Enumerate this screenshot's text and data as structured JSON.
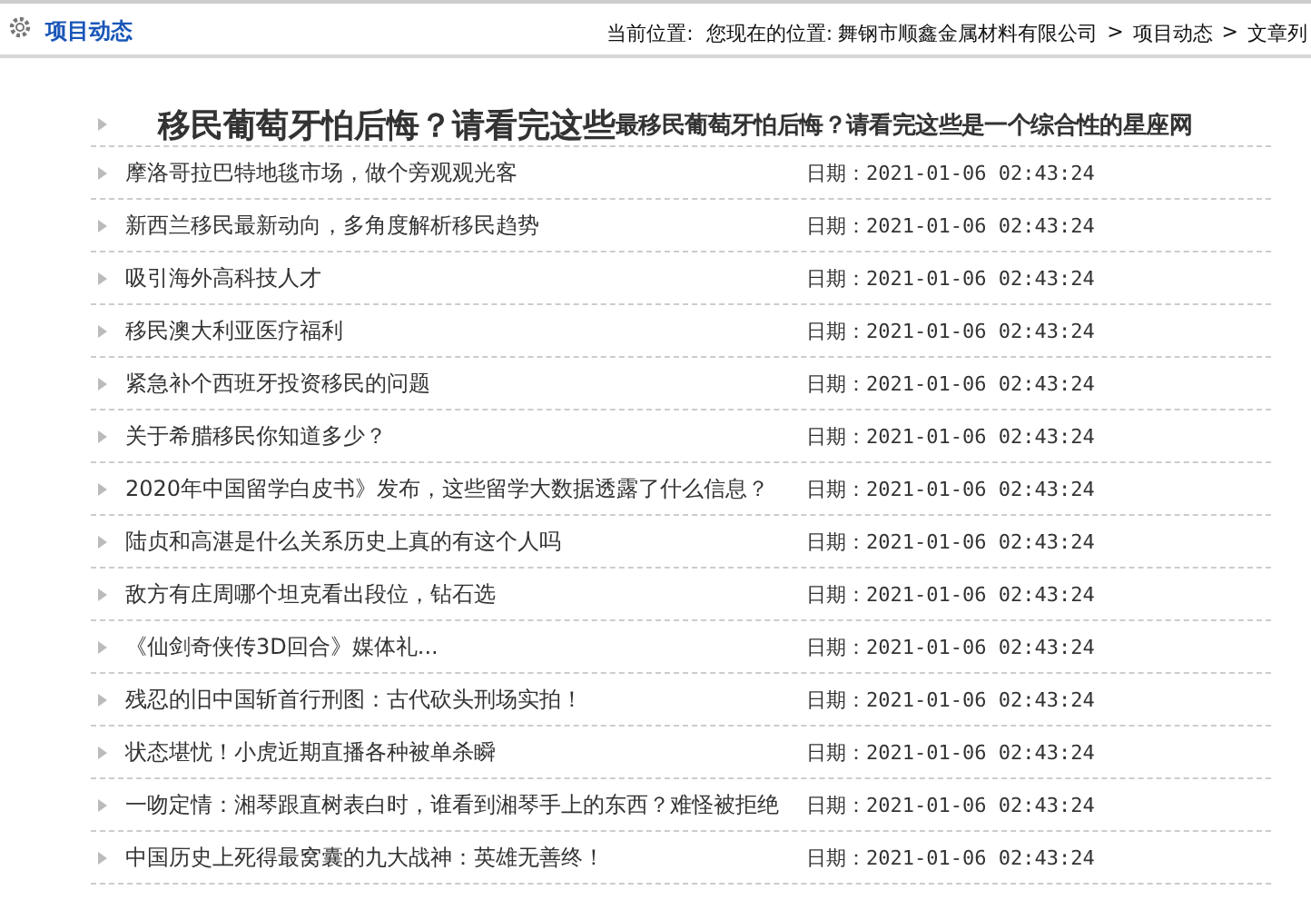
{
  "header": {
    "title": "项目动态",
    "breadcrumb_label": "当前位置:",
    "breadcrumb": [
      {
        "text": "您现在的位置:",
        "kind": "text"
      },
      {
        "text": "舞钢市顺鑫金属材料有限公司",
        "kind": "link"
      },
      {
        "text": ">",
        "kind": "sep"
      },
      {
        "text": "项目动态",
        "kind": "link"
      },
      {
        "text": ">",
        "kind": "sep"
      },
      {
        "text": "文章列",
        "kind": "link"
      }
    ]
  },
  "headline": {
    "title": "移民葡萄牙怕后悔？请看完这些",
    "subtitle": "最移民葡萄牙怕后悔？请看完这些是一个综合性的星座网"
  },
  "articles": [
    {
      "title": "摩洛哥拉巴特地毯市场，做个旁观观光客",
      "date": "日期：2021-01-06 02:43:24"
    },
    {
      "title": "新西兰移民最新动向，多角度解析移民趋势",
      "date": "日期：2021-01-06 02:43:24"
    },
    {
      "title": "吸引海外高科技人才",
      "date": "日期：2021-01-06 02:43:24"
    },
    {
      "title": "移民澳大利亚医疗福利",
      "date": "日期：2021-01-06 02:43:24"
    },
    {
      "title": "紧急补个西班牙投资移民的问题",
      "date": "日期：2021-01-06 02:43:24"
    },
    {
      "title": "关于希腊移民你知道多少？",
      "date": "日期：2021-01-06 02:43:24"
    },
    {
      "title": "2020年中国留学白皮书》发布，这些留学大数据透露了什么信息？",
      "date": "日期：2021-01-06 02:43:24"
    },
    {
      "title": "陆贞和高湛是什么关系历史上真的有这个人吗",
      "date": "日期：2021-01-06 02:43:24"
    },
    {
      "title": "敌方有庄周哪个坦克看出段位，钻石选",
      "date": "日期：2021-01-06 02:43:24"
    },
    {
      "title": "《仙剑奇侠传3D回合》媒体礼...",
      "date": "日期：2021-01-06 02:43:24"
    },
    {
      "title": "残忍的旧中国斩首行刑图：古代砍头刑场实拍！",
      "date": "日期：2021-01-06 02:43:24"
    },
    {
      "title": "状态堪忧！小虎近期直播各种被单杀瞬",
      "date": "日期：2021-01-06 02:43:24"
    },
    {
      "title": "一吻定情：湘琴跟直树表白时，谁看到湘琴手上的东西？难怪被拒绝",
      "date": "日期：2021-01-06 02:43:24"
    },
    {
      "title": "中国历史上死得最窝囊的九大战神：英雄无善终！",
      "date": "日期：2021-01-06 02:43:24"
    }
  ]
}
